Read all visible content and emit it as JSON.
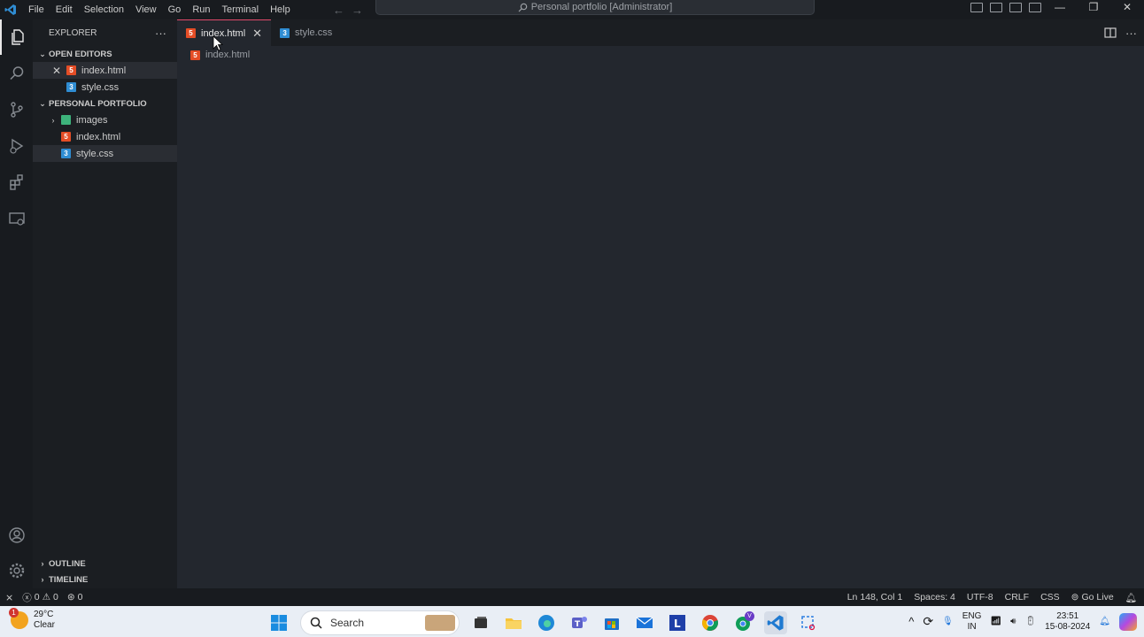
{
  "titlebar": {
    "menu": [
      "File",
      "Edit",
      "Selection",
      "View",
      "Go",
      "Run",
      "Terminal",
      "Help"
    ],
    "command_center": "Personal portfolio [Administrator]",
    "back_icon": "arrow-left-icon",
    "forward_icon": "arrow-right-icon"
  },
  "sidebar": {
    "title": "EXPLORER",
    "more": "···",
    "open_editors_label": "OPEN EDITORS",
    "open_editors": [
      {
        "name": "index.html",
        "type": "html"
      },
      {
        "name": "style.css",
        "type": "css"
      }
    ],
    "folder_label": "PERSONAL PORTFOLIO",
    "files": [
      {
        "name": "images",
        "type": "folder"
      },
      {
        "name": "index.html",
        "type": "html"
      },
      {
        "name": "style.css",
        "type": "css"
      }
    ],
    "outline_label": "OUTLINE",
    "timeline_label": "TIMELINE"
  },
  "editor": {
    "tabs": [
      {
        "label": "index.html",
        "active": true
      },
      {
        "label": "style.css",
        "active": false
      }
    ],
    "breadcrumb": "index.html"
  },
  "statusbar": {
    "errors": "0",
    "warnings": "0",
    "ports": "0",
    "position": "Ln 148, Col 1",
    "spaces": "Spaces: 4",
    "encoding": "UTF-8",
    "eol": "CRLF",
    "language": "CSS",
    "go_live": "Go Live"
  },
  "taskbar": {
    "weather_badge": "1",
    "temperature": "29°C",
    "condition": "Clear",
    "search_label": "Search",
    "lang_top": "ENG",
    "lang_bottom": "IN",
    "time": "23:51",
    "date": "15-08-2024",
    "chrome_badge": "V"
  },
  "colors": {
    "accent_tab": "#e04a6a",
    "html_icon": "#e44d26",
    "css_icon": "#2f8dd3",
    "editor_bg": "#23272e",
    "sidebar_bg": "#1b1e22",
    "taskbar_bg": "#e9eef5"
  }
}
